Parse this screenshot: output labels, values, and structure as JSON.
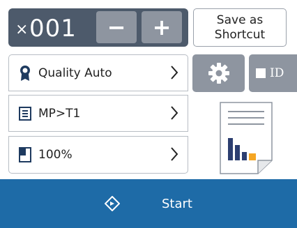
{
  "copies": {
    "prefix": "×",
    "value": "001",
    "minus_label": "−",
    "plus_label": "+"
  },
  "shortcut": {
    "line1": "Save as",
    "line2": "Shortcut"
  },
  "settings_list": [
    {
      "label": "Quality Auto",
      "icon": "quality-ribbon-icon"
    },
    {
      "label": "MP>T1",
      "icon": "tray-list-icon"
    },
    {
      "label": "100%",
      "icon": "enlarge-reduce-icon"
    }
  ],
  "tools": {
    "settings_icon": "gear-icon",
    "id_label": "ID"
  },
  "start": {
    "label": "Start",
    "icon": "start-diamond-icon"
  },
  "colors": {
    "counter_bg": "#4d5a6b",
    "button_gray": "#8e95a0",
    "start_blue": "#1e6ba7",
    "preview_orange": "#f5a623",
    "preview_bars": "#2c3e70"
  }
}
